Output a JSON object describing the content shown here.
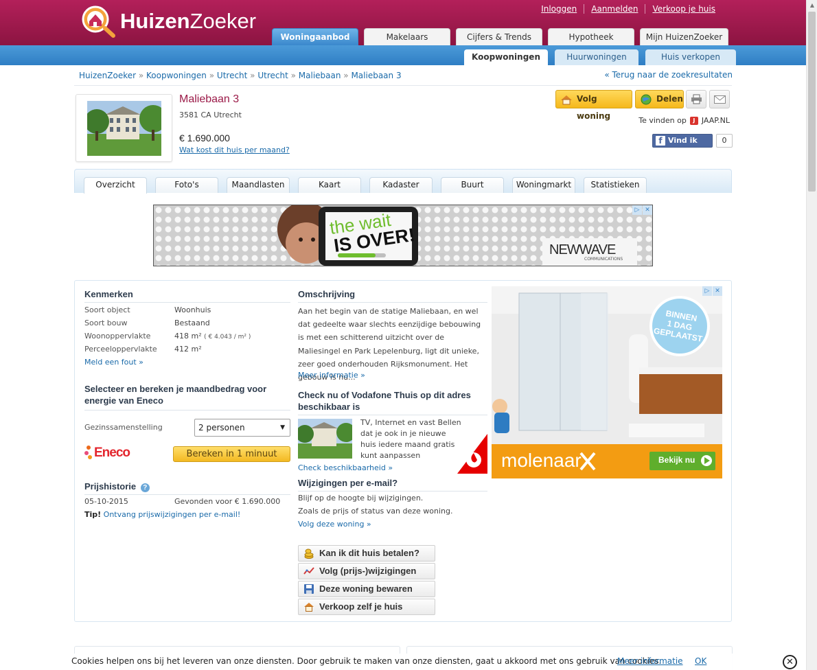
{
  "header": {
    "logo": {
      "bold": "Huizen",
      "light": "Zoeker"
    },
    "top_links": [
      "Inloggen",
      "Aanmelden",
      "Verkoop je huis"
    ],
    "main_tabs": [
      "Woningaanbod",
      "Makelaars",
      "Cijfers & Trends",
      "Hypotheek",
      "Mijn HuizenZoeker"
    ],
    "sub_tabs": [
      "Koopwoningen",
      "Huurwoningen",
      "Huis verkopen"
    ]
  },
  "breadcrumb": [
    "HuizenZoeker",
    "Koopwoningen",
    "Utrecht",
    "Utrecht",
    "Maliebaan",
    "Maliebaan 3"
  ],
  "back_link": "« Terug naar de zoekresultaten",
  "listing": {
    "title": "Maliebaan 3",
    "postcode": "3581 CA Utrecht",
    "price": "€ 1.690.000",
    "month_cost_link": "Wat kost dit huis per maand?",
    "follow_label": "Volg woning",
    "share_label": "Delen",
    "found_on": "Te vinden op",
    "found_site": "JAAP.NL",
    "fb_like": "Vind ik leuk",
    "fb_count": "0"
  },
  "detail_tabs": [
    "Overzicht",
    "Foto's",
    "Maandlasten",
    "Kaart",
    "Kadaster",
    "Buurt",
    "Woningmarkt",
    "Statistieken"
  ],
  "banner_ad": {
    "line1": "the wait",
    "line2": "IS OVER!",
    "brand": "NEWWAVE",
    "brand_sub": "COMMUNICATIONS"
  },
  "kenmerken": {
    "heading": "Kenmerken",
    "rows": [
      {
        "label": "Soort object",
        "value": "Woonhuis"
      },
      {
        "label": "Soort bouw",
        "value": "Bestaand"
      },
      {
        "label": "Woonoppervlakte",
        "value": "418 m²",
        "extra": "( € 4.043 / m² )"
      },
      {
        "label": "Perceeloppervlakte",
        "value": "412 m²"
      }
    ],
    "report_link": "Meld een fout »"
  },
  "energy": {
    "heading": "Selecteer en bereken je maandbedrag voor energie van Eneco",
    "household_label": "Gezinssamenstelling",
    "household_value": "2 personen",
    "brand": "Eneco",
    "calc_button": "Bereken in 1 minuut"
  },
  "price_history": {
    "heading": "Prijshistorie",
    "rows": [
      {
        "date": "05-10-2015",
        "text": "Gevonden voor € 1.690.000"
      }
    ],
    "tip_label": "Tip!",
    "tip_link": "Ontvang prijswijzigingen per e-mail!"
  },
  "description": {
    "heading": "Omschrijving",
    "text": "Aan het begin van de statige Maliebaan, en wel dat gedeelte waar slechts eenzijdige bebouwing is met een schitterend uitzicht over de Maliesingel en Park Lepelenburg, ligt dit unieke, zeer goed onderhouden Rijksmonument. Het gebouw is nu...",
    "more_link": "Meer informatie »"
  },
  "vodafone": {
    "heading": "Check nu of Vodafone Thuis op dit adres beschikbaar is",
    "text": "TV, Internet en vast Bellen dat je ook in je nieuwe huis iedere maand gratis kunt aanpassen",
    "link": "Check beschikbaarheid »"
  },
  "email_changes": {
    "heading": "Wijzigingen per e-mail?",
    "line1": "Blijf op de hoogte bij wijzigingen.",
    "line2": "Zoals de prijs of status van deze woning.",
    "link": "Volg deze woning »"
  },
  "actions": [
    "Kan ik dit huis betalen?",
    "Volg (prijs-)wijzigingen",
    "Deze woning bewaren",
    "Verkoop zelf je huis"
  ],
  "side_ad": {
    "badge": [
      "BINNEN",
      "1 DAG",
      "GEPLAATST"
    ],
    "brand": "molenaar",
    "cta": "Bekijk nu"
  },
  "cookie_bar": {
    "text": "Cookies helpen ons bij het leveren van onze diensten. Door gebruik te maken van onze diensten, gaat u akkoord met ons gebruik van cookies.",
    "more": "Meer informatie",
    "ok": "OK"
  },
  "colors": {
    "brand": "#a01a4f",
    "nav_blue": "#3a88cc",
    "link": "#1a6aa9",
    "button_yellow": "#f5b81b"
  }
}
